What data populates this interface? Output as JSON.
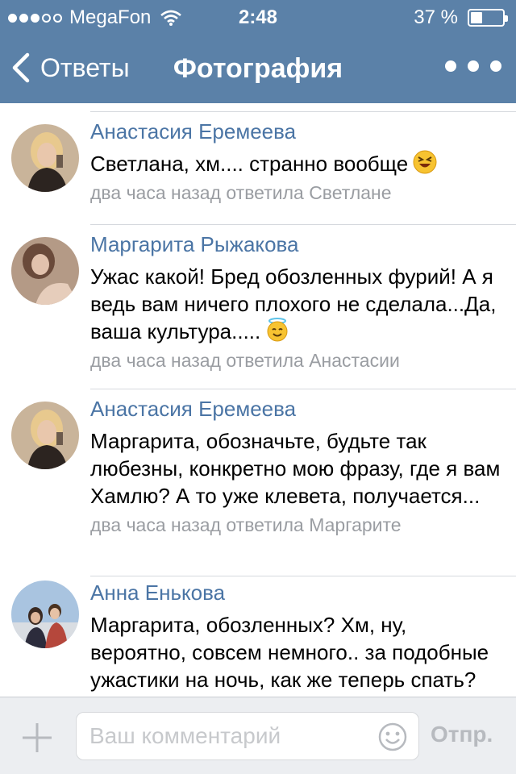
{
  "status_bar": {
    "carrier": "MegaFon",
    "time": "2:48",
    "battery": "37 %",
    "signal_bars": 3,
    "battery_level": 0.37
  },
  "nav": {
    "back_label": "Ответы",
    "title": "Фотография"
  },
  "comments": [
    {
      "author": "Анастасия Еремеева",
      "text": "Светлана, хм.... странно вообще",
      "emoji": "laughing-emoji-icon",
      "meta": "два часа назад ответила Светлане"
    },
    {
      "author": "Маргарита Рыжакова",
      "text": "Ужас какой! Бред обозленных фурий! А я ведь вам ничего плохого не сделала...Да, ваша культура.....",
      "emoji": "angel-emoji-icon",
      "meta": "два часа назад ответила Анастасии"
    },
    {
      "author": "Анастасия Еремеева",
      "text": "Маргарита, обозначьте, будьте так любезны, конкретно мою фразу, где я вам Хамлю? А то уже клевета, получается...",
      "meta": "два часа назад ответила Маргарите"
    },
    {
      "author": "Анна Енькова",
      "text": "Маргарита, обозленных? Хм, ну, вероятно, совсем немного.. за подобные ужастики на ночь, как же теперь спать?",
      "meta": ""
    }
  ],
  "composer": {
    "placeholder": "Ваш комментарий",
    "send_label": "Отпр."
  },
  "colors": {
    "header": "#5b81a8",
    "author_link": "#4b75a5",
    "meta": "#9a9da2",
    "composer_bg": "#eceef1"
  }
}
